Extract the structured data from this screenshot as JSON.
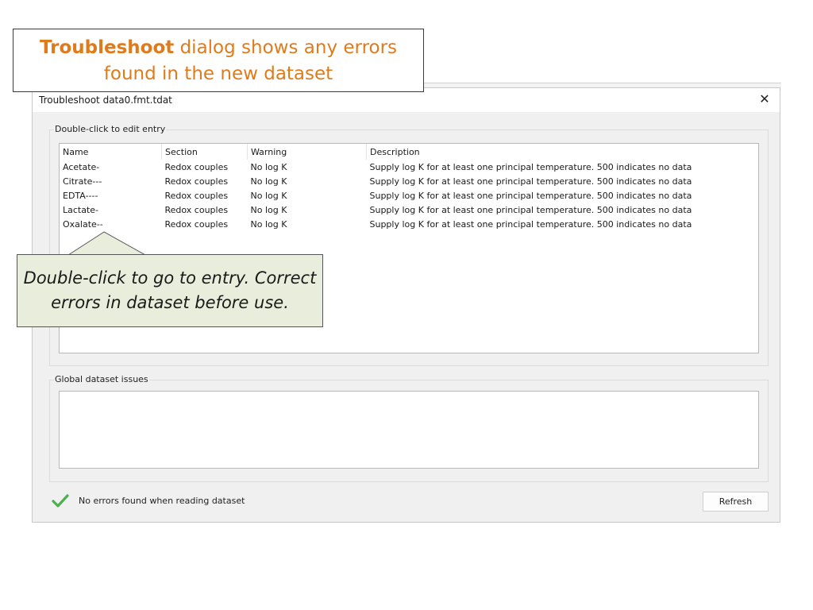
{
  "callout_top": {
    "bold": "Troubleshoot",
    "rest_line1": " dialog shows any errors",
    "line2": "found in the new dataset"
  },
  "callout_bottom": {
    "line1": "Double-click to go to entry. Correct",
    "line2": "errors in dataset before use."
  },
  "dialog": {
    "title": "Troubleshoot data0.fmt.tdat",
    "close_glyph": "✕",
    "entries_group_label": "Double-click to edit entry",
    "columns": [
      "Name",
      "Section",
      "Warning",
      "Description"
    ],
    "rows": [
      [
        "Acetate-",
        "Redox couples",
        "No log K",
        "Supply log K for at least one principal temperature. 500 indicates no data"
      ],
      [
        "Citrate---",
        "Redox couples",
        "No log K",
        "Supply log K for at least one principal temperature. 500 indicates no data"
      ],
      [
        "EDTA----",
        "Redox couples",
        "No log K",
        "Supply log K for at least one principal temperature. 500 indicates no data"
      ],
      [
        "Lactate-",
        "Redox couples",
        "No log K",
        "Supply log K for at least one principal temperature. 500 indicates no data"
      ],
      [
        "Oxalate--",
        "Redox couples",
        "No log K",
        "Supply log K for at least one principal temperature. 500 indicates no data"
      ]
    ],
    "global_group_label": "Global dataset issues",
    "status_icon": "check-icon",
    "status_text": "No errors found when reading dataset",
    "refresh_label": "Refresh"
  },
  "colors": {
    "callout_text": "#e07b1c",
    "callout_note_bg": "#e9eedc",
    "check": "#4caf50"
  }
}
